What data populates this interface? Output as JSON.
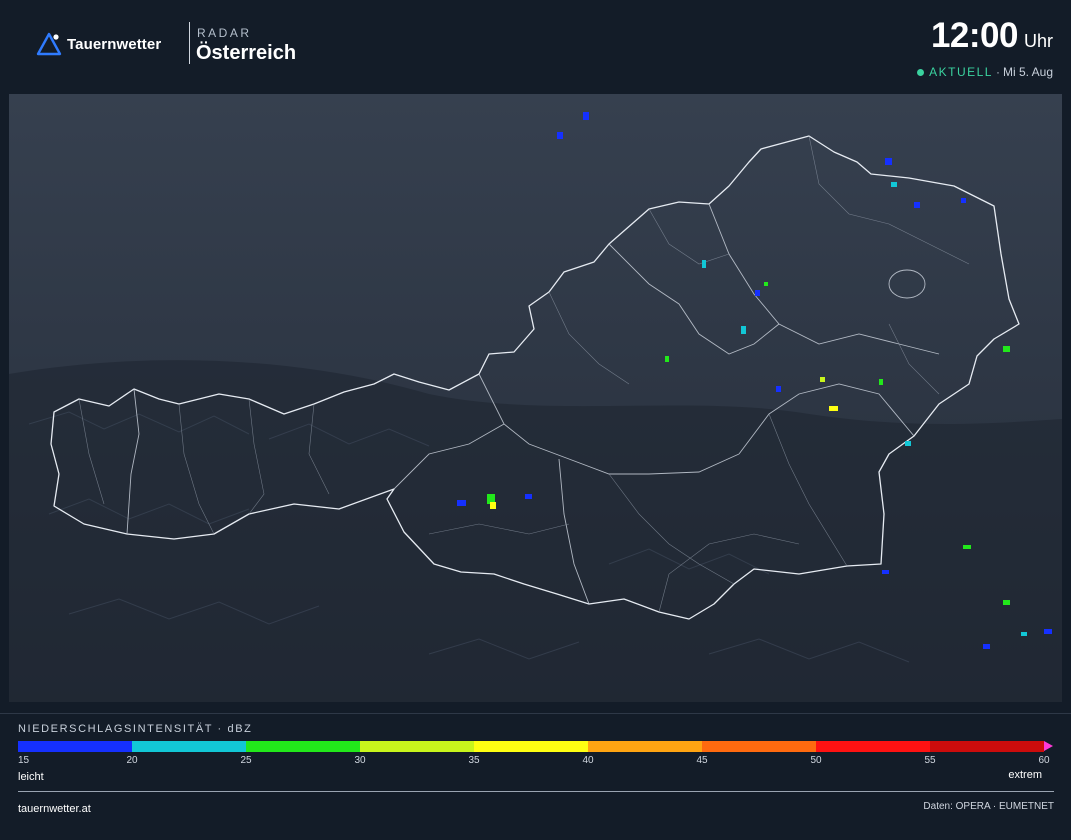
{
  "header": {
    "brand": "Tauernwetter",
    "kicker": "RADAR",
    "title": "Österreich",
    "time": "12:00",
    "time_unit": "Uhr",
    "status_live": "AKTUELL",
    "status_sep": "·",
    "status_date": "Mi 5. Aug"
  },
  "icons": [
    "triangle-logo-icon",
    "live-dot-icon",
    "scale-arrow-icon"
  ],
  "colors": {
    "background": "#131c28",
    "accent_live": "#3ad29f",
    "logo_blue": "#2f7bff",
    "border": "#e6ebf2"
  },
  "legend": {
    "title": "NIEDERSCHLAGSINTENSITÄT · dBZ",
    "ticks": [
      "15",
      "20",
      "25",
      "30",
      "35",
      "40",
      "45",
      "50",
      "55",
      "60"
    ],
    "colors": [
      "#1530ff",
      "#12c7d6",
      "#22e81b",
      "#c8f51c",
      "#ffff12",
      "#ffa412",
      "#ff6a0f",
      "#ff1212",
      "#cc0c0c"
    ],
    "label_low": "leicht",
    "label_high": "extrem"
  },
  "footer": {
    "site": "tauernwetter.at",
    "source": "Daten: OPERA · EUMETNET"
  }
}
